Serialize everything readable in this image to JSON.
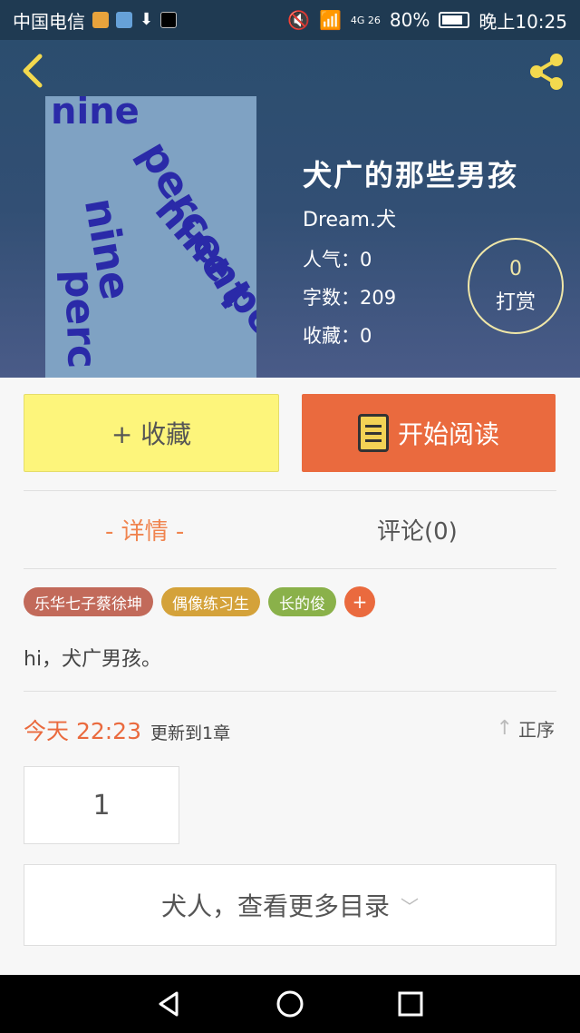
{
  "status_bar": {
    "carrier": "中国电信",
    "network": "4G 26",
    "battery": "80%",
    "time": "晚上10:25"
  },
  "book": {
    "cover_words": [
      "nine",
      "percent",
      "nine",
      "perc",
      "nine perc"
    ],
    "title": "犬广的那些男孩",
    "author": "Dream.犬",
    "popularity": "人气：0",
    "word_count": "字数：209",
    "favorites": "收藏：0"
  },
  "tip": {
    "count": "0",
    "label": "打赏"
  },
  "actions": {
    "favorite_label": "+ 收藏",
    "read_label": "开始阅读"
  },
  "tabs": {
    "detail": "- 详情 -",
    "comments": "评论(0)"
  },
  "tags": [
    {
      "label": "乐华七子蔡徐坤",
      "color": "#c26a5a"
    },
    {
      "label": "偶像练习生",
      "color": "#d4a23a"
    },
    {
      "label": "长的俊",
      "color": "#8ab14a"
    }
  ],
  "tag_add": "+",
  "description": "hi，犬广男孩。",
  "update": {
    "time": "今天 22:23",
    "info": "更新到1章",
    "sort": "正序"
  },
  "chapters": [
    "1"
  ],
  "more_catalog": "犬人，查看更多目录",
  "colors": {
    "accent": "#ea6a3e",
    "favorite_bg": "#fdf57b",
    "header_bg": "#2b4d6e"
  }
}
